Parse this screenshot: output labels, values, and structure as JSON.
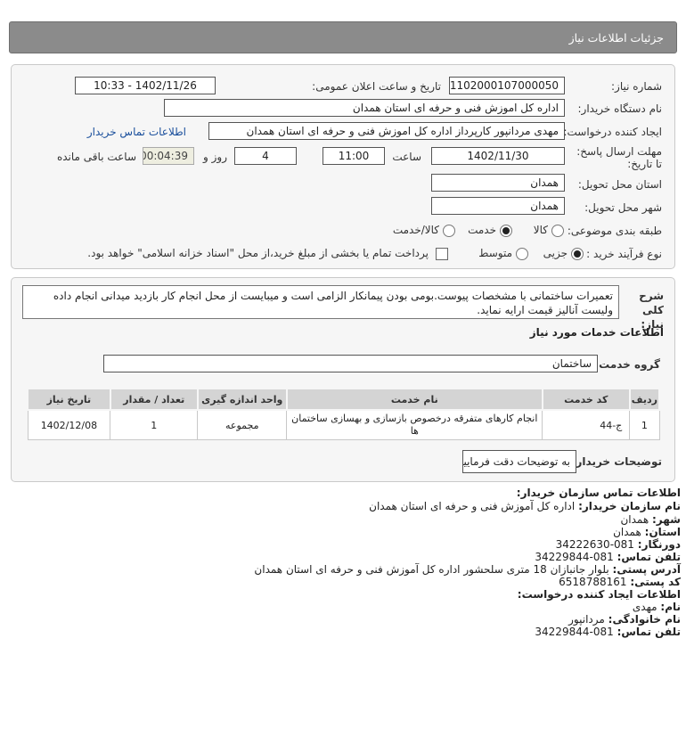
{
  "page": {
    "title": "جزئیات اطلاعات نیاز"
  },
  "need": {
    "need_number_label": "شماره نیاز:",
    "need_number": "1102000107000050",
    "announce_label": "تاریخ و ساعت اعلان عمومی:",
    "announce_value": "1402/11/26 - 10:33",
    "buyer_label": "نام دستگاه خریدار:",
    "buyer_value": "اداره کل اموزش فنی و حرفه ای استان همدان",
    "creator_label": "ایجاد کننده درخواست:",
    "creator_value": "مهدی مردانپور کارپرداز اداره کل اموزش فنی و حرفه ای استان همدان",
    "contact_link": "اطلاعات تماس خریدار",
    "deadline_label": "مهلت ارسال پاسخ: تا تاریخ:",
    "deadline_date": "1402/11/30",
    "time_label": "ساعت",
    "deadline_time": "11:00",
    "days_value": "4",
    "days_label": "روز و",
    "remaining_time": "00:04:39",
    "remaining_label": "ساعت باقی مانده",
    "province_label": "استان محل تحویل:",
    "province_value": "همدان",
    "city_label": "شهر محل تحویل:",
    "city_value": "همدان",
    "category_label": "طبقه بندی موضوعی:",
    "category_options": [
      "کالا",
      "خدمت",
      "کالا/خدمت"
    ],
    "category_selected": "خدمت",
    "process_label": "نوع فرآیند خرید :",
    "process_options": [
      "جزیی",
      "متوسط"
    ],
    "process_selected": "جزیی",
    "payment_note": "پرداخت تمام یا بخشی از مبلغ خرید،از محل \"اسناد خزانه اسلامی\" خواهد بود."
  },
  "description": {
    "label": "شرح کلی نیاز:",
    "text": "تعمیرات ساختمانی با مشخصات پیوست.بومی بودن پیمانکار الزامی است و میبایست از محل انجام کار بازدید میدانی انجام داده ولیست آنالیز قیمت ارایه نماید."
  },
  "services": {
    "section_title": "اطلاعات خدمات مورد نیاز",
    "group_label": "گروه خدمت:",
    "group_value": "ساختمان",
    "columns": [
      "ردیف",
      "کد خدمت",
      "نام خدمت",
      "واحد اندازه گیری",
      "تعداد / مقدار",
      "تاریخ نیاز"
    ],
    "rows": [
      {
        "row": "1",
        "code": "ج-44",
        "name": "انجام کارهای متفرقه درخصوص بازسازی و بهسازی ساختمان ها",
        "unit": "مجموعه",
        "qty": "1",
        "date": "1402/12/08"
      }
    ],
    "buyer_notes_label": "توضیحات خریدار:",
    "buyer_notes_value": "به توضیحات دقت فرمایید"
  },
  "contact": {
    "org_title": "اطلاعات تماس سازمان خریدار:",
    "buyer_name_label": "نام سازمان خریدار:",
    "buyer_name": "اداره کل آموزش فنی و حرفه ای استان همدان",
    "city_label": "شهر:",
    "city": "همدان",
    "province_label": "استان:",
    "province": "همدان",
    "fax_label": "دورنگار:",
    "fax": "081-34222630",
    "phone_label": "تلفن تماس:",
    "phone": "081-34229844",
    "address_label": "آدرس پستی:",
    "address": "بلوار جانبازان 18 متری سلحشور اداره کل آموزش فنی و حرفه ای استان همدان",
    "postal_label": "کد پستی:",
    "postal": "6518788161",
    "creator_title": "اطلاعات ایجاد کننده درخواست:",
    "first_name_label": "نام:",
    "first_name": "مهدی",
    "last_name_label": "نام خانوادگی:",
    "last_name": "مردانپور",
    "creator_phone_label": "تلفن تماس:",
    "creator_phone": "081-34229844"
  }
}
